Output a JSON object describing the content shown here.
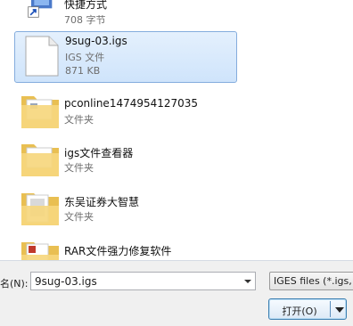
{
  "files": [
    {
      "name": "快捷方式",
      "line2": "708 字节",
      "line3": "",
      "icon": "shortcut-icon"
    },
    {
      "name": "9sug-03.igs",
      "line2": "IGS 文件",
      "line3": "871 KB",
      "icon": "document-icon",
      "selected": true
    },
    {
      "name": "pconline1474954127035",
      "line2": "文件夹",
      "line3": "",
      "icon": "folder-icon"
    },
    {
      "name": "igs文件查看器",
      "line2": "文件夹",
      "line3": "",
      "icon": "folder-icon"
    },
    {
      "name": "东吴证券大智慧",
      "line2": "文件夹",
      "line3": "",
      "icon": "folder-icon"
    },
    {
      "name": "RAR文件强力修复软件",
      "line2": "",
      "line3": "",
      "icon": "folder-icon"
    }
  ],
  "bottom_bar": {
    "filename_label": "名(N):",
    "filename_value": "9sug-03.igs",
    "filter_value": "IGES files (*.igs,",
    "open_label": "打开(O)"
  },
  "colors": {
    "selection": "#cfe4fb",
    "selection_border": "#84acdd",
    "folder": "#f4d37a"
  }
}
